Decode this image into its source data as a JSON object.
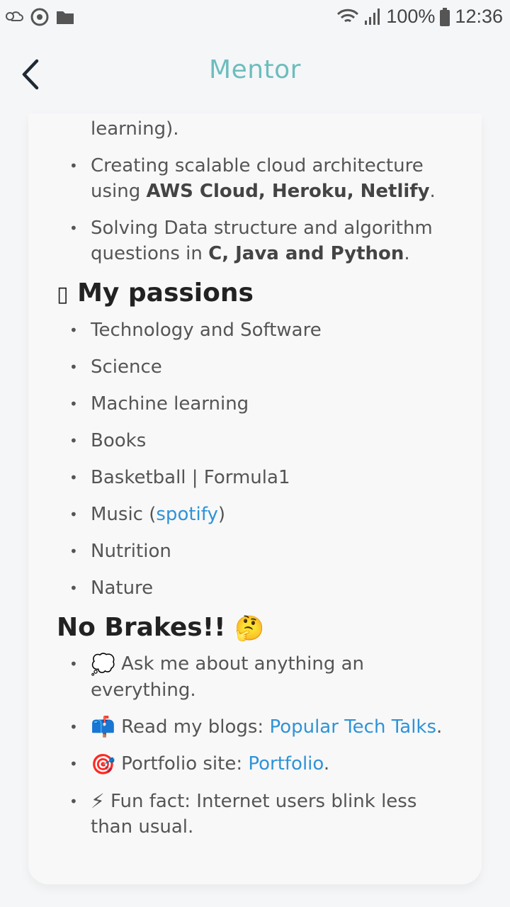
{
  "status": {
    "battery": "100%",
    "time": "12:36"
  },
  "header": {
    "title": "Mentor"
  },
  "skills": [
    {
      "pre": "learning).",
      "bold": "",
      "post": ""
    },
    {
      "pre": "Creating scalable cloud architecture using ",
      "bold": "AWS Cloud, Heroku, Netlify",
      "post": "."
    },
    {
      "pre": "Solving Data structure and algorithm questions in ",
      "bold": "C, Java and Python",
      "post": "."
    }
  ],
  "passions": {
    "icon": "▯",
    "title": "My passions",
    "items": [
      "Technology and Software",
      "Science",
      "Machine learning",
      "Books",
      "Basketball | Formula1"
    ],
    "music_pre": "Music (",
    "music_link": "spotify",
    "music_post": ")",
    "items2": [
      "Nutrition",
      "Nature"
    ]
  },
  "no_brakes": {
    "title": "No Brakes!!",
    "title_emoji": "🤔",
    "items": [
      {
        "emoji": "💭",
        "text": "Ask me about anything an everything.",
        "link": "",
        "after": ""
      },
      {
        "emoji": "📫",
        "text": "Read my blogs: ",
        "link": "Popular Tech Talks",
        "after": "."
      },
      {
        "emoji": "🎯",
        "text": "Portfolio site: ",
        "link": "Portfolio",
        "after": "."
      },
      {
        "emoji": "⚡",
        "text": "Fun fact: Internet users blink less than usual.",
        "link": "",
        "after": ""
      }
    ]
  }
}
